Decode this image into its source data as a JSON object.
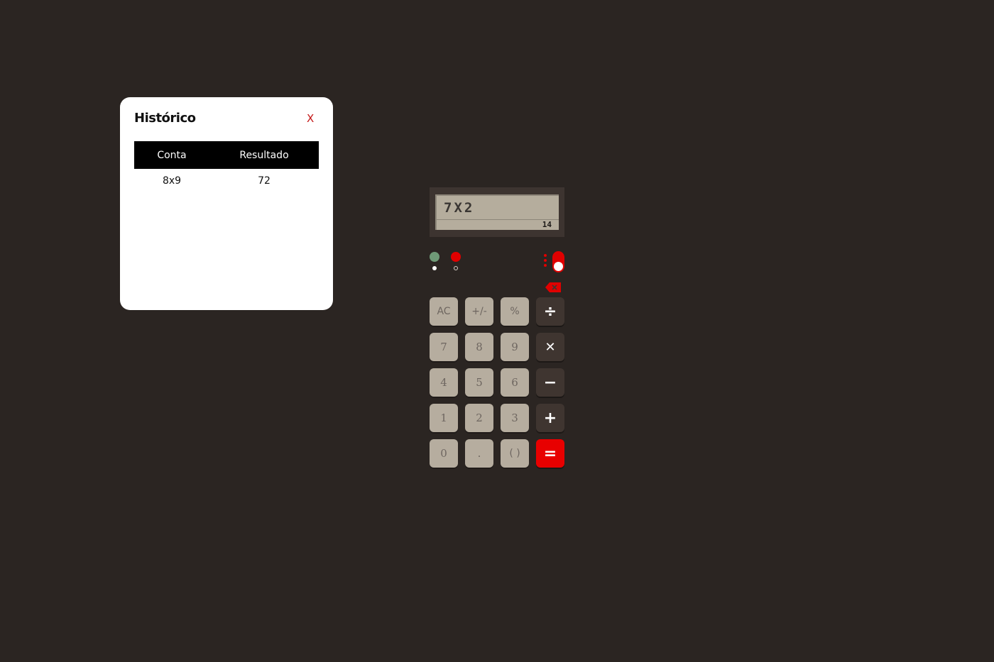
{
  "history": {
    "title": "Histórico",
    "close_label": "X",
    "columns": [
      "Conta",
      "Resultado"
    ],
    "rows": [
      {
        "conta": "8x9",
        "resultado": "72"
      }
    ]
  },
  "display": {
    "expression": "7X2",
    "result": "14"
  },
  "theme": {
    "options": [
      {
        "name": "green",
        "color": "#6f9a77",
        "selected": true
      },
      {
        "name": "red",
        "color": "#e00000",
        "selected": false
      }
    ],
    "toggle_color": "#e00000",
    "toggle_on": true
  },
  "keys": {
    "ac": "AC",
    "sign": "+/-",
    "percent": "%",
    "divide": "÷",
    "seven": "7",
    "eight": "8",
    "nine": "9",
    "multiply": "✕",
    "four": "4",
    "five": "5",
    "six": "6",
    "minus": "−",
    "one": "1",
    "two": "2",
    "three": "3",
    "plus": "+",
    "zero": "0",
    "dot": ".",
    "parens": "( )",
    "equals": "="
  },
  "icons": {
    "backspace": "backspace-icon",
    "close": "close-icon"
  }
}
